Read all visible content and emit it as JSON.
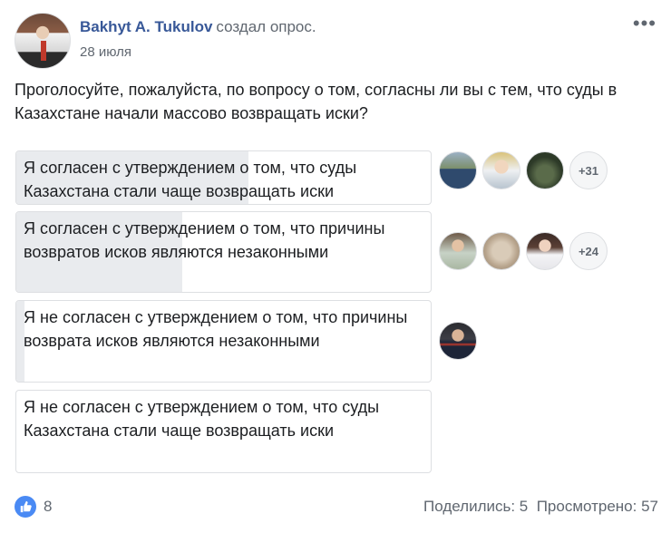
{
  "post": {
    "author": "Bakhyt A. Tukulov",
    "action": "создал опрос.",
    "date": "28 июля",
    "question": "Проголосуйте, пожалуйста, по вопросу о том, согласны ли вы с тем, что суды в Казахстане начали массово возвращать иски?"
  },
  "poll": {
    "options": [
      {
        "text": "Я согласен с утверждением о том, что суды Казахстана стали чаще возвращать иски",
        "share": 0.56,
        "more_voters": "+31"
      },
      {
        "text": "Я согласен с утверждением о том, что причины возвратов исков являются незаконными",
        "share": 0.4,
        "more_voters": "+24"
      },
      {
        "text": "Я не согласен с утверждением о том, что причины возврата исков являются незаконными",
        "share": 0.02,
        "more_voters": ""
      },
      {
        "text": "Я не согласен с утверждением о том, что суды Казахстана стали чаще возвращать иски",
        "share": 0.0,
        "more_voters": ""
      }
    ]
  },
  "footer": {
    "likes": "8",
    "shares": "Поделились: 5",
    "views": "Просмотрено: 57"
  },
  "colors": {
    "link": "#385898",
    "poll_fill": "#e9ebee",
    "like": "#4a8af4"
  }
}
